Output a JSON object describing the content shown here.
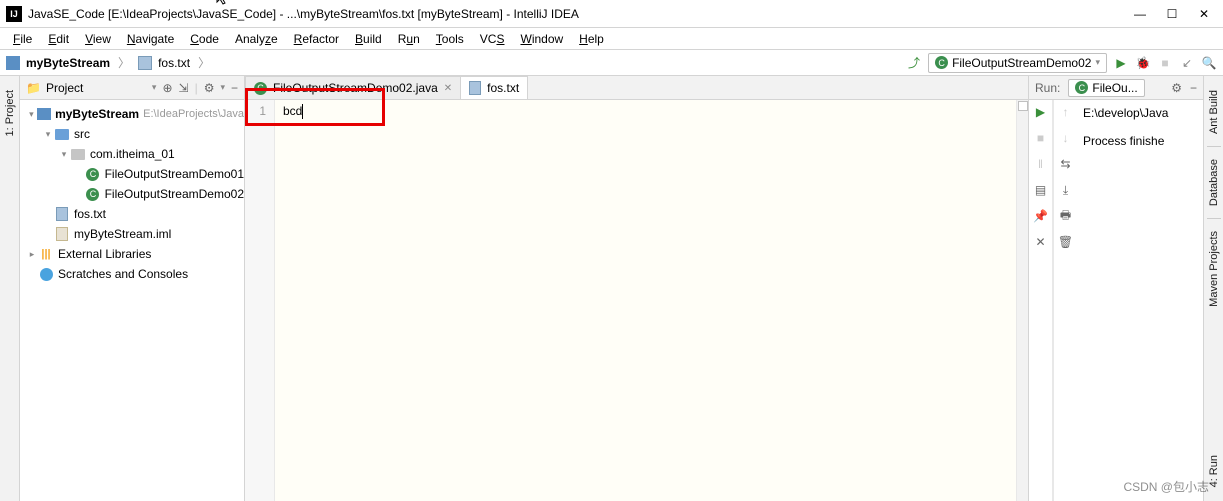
{
  "window": {
    "title": "JavaSE_Code [E:\\IdeaProjects\\JavaSE_Code] - ...\\myByteStream\\fos.txt [myByteStream] - IntelliJ IDEA"
  },
  "menu": {
    "file": "File",
    "edit": "Edit",
    "view": "View",
    "navigate": "Navigate",
    "code": "Code",
    "analyze": "Analyze",
    "refactor": "Refactor",
    "build": "Build",
    "run": "Run",
    "tools": "Tools",
    "vcs": "VCS",
    "window": "Window",
    "help": "Help"
  },
  "breadcrumb": {
    "item0": "myByteStream",
    "item1": "fos.txt"
  },
  "runConfig": {
    "name": "FileOutputStreamDemo02"
  },
  "projectPanel": {
    "title": "Project"
  },
  "tree": {
    "n0": "myByteStream",
    "n0path": "E:\\IdeaProjects\\Java",
    "n1": "src",
    "n2": "com.itheima_01",
    "n3": "FileOutputStreamDemo01",
    "n4": "FileOutputStreamDemo02",
    "n5": "fos.txt",
    "n6": "myByteStream.iml",
    "n7": "External Libraries",
    "n8": "Scratches and Consoles"
  },
  "tabs": {
    "t0": "FileOutputStreamDemo02.java",
    "t1": "fos.txt"
  },
  "editor": {
    "line1_num": "1",
    "line1_text": "bcd"
  },
  "run": {
    "title": "Run:",
    "tab": "FileOu...",
    "out_line1": "E:\\develop\\Java",
    "out_line2": "Process finishe"
  },
  "rightStrip": {
    "t0": "Ant Build",
    "t1": "Database",
    "t2": "Maven Projects"
  },
  "leftStrip": {
    "t0": "1: Project"
  },
  "bottomRight": {
    "t0": "4: Run"
  },
  "watermark": "CSDN @包小志"
}
